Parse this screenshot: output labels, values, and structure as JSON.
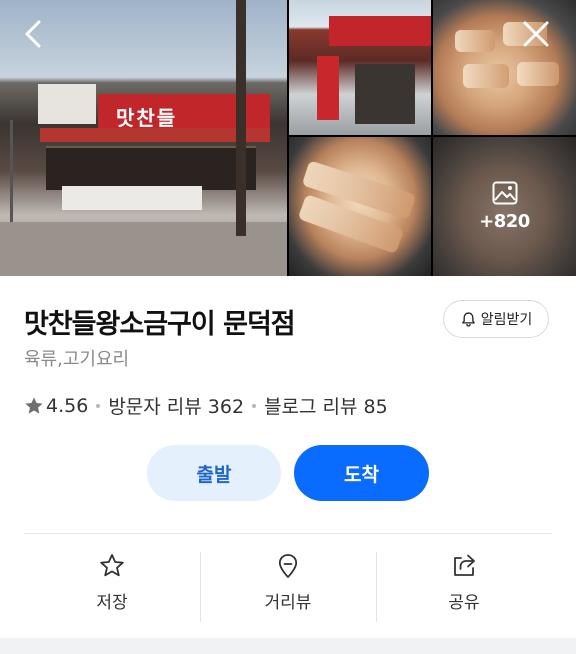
{
  "gallery": {
    "more_count": "+820",
    "store_sign_text": "맛찬들"
  },
  "place": {
    "name": "맛찬들왕소금구이 문덕점",
    "category": "육류,고기요리",
    "rating": "4.56",
    "visitor_reviews": "방문자 리뷰 362",
    "blog_reviews": "블로그 리뷰 85"
  },
  "notify": {
    "label": "알림받기"
  },
  "buttons": {
    "start": "출발",
    "arrive": "도착"
  },
  "actions": [
    {
      "label": "저장",
      "icon": "star-outline-icon"
    },
    {
      "label": "거리뷰",
      "icon": "map-pin-icon"
    },
    {
      "label": "공유",
      "icon": "share-icon"
    }
  ],
  "colors": {
    "primary": "#0a6cff",
    "primary_light": "#e4f0fc",
    "text": "#111111",
    "muted": "#8a8a8a"
  }
}
